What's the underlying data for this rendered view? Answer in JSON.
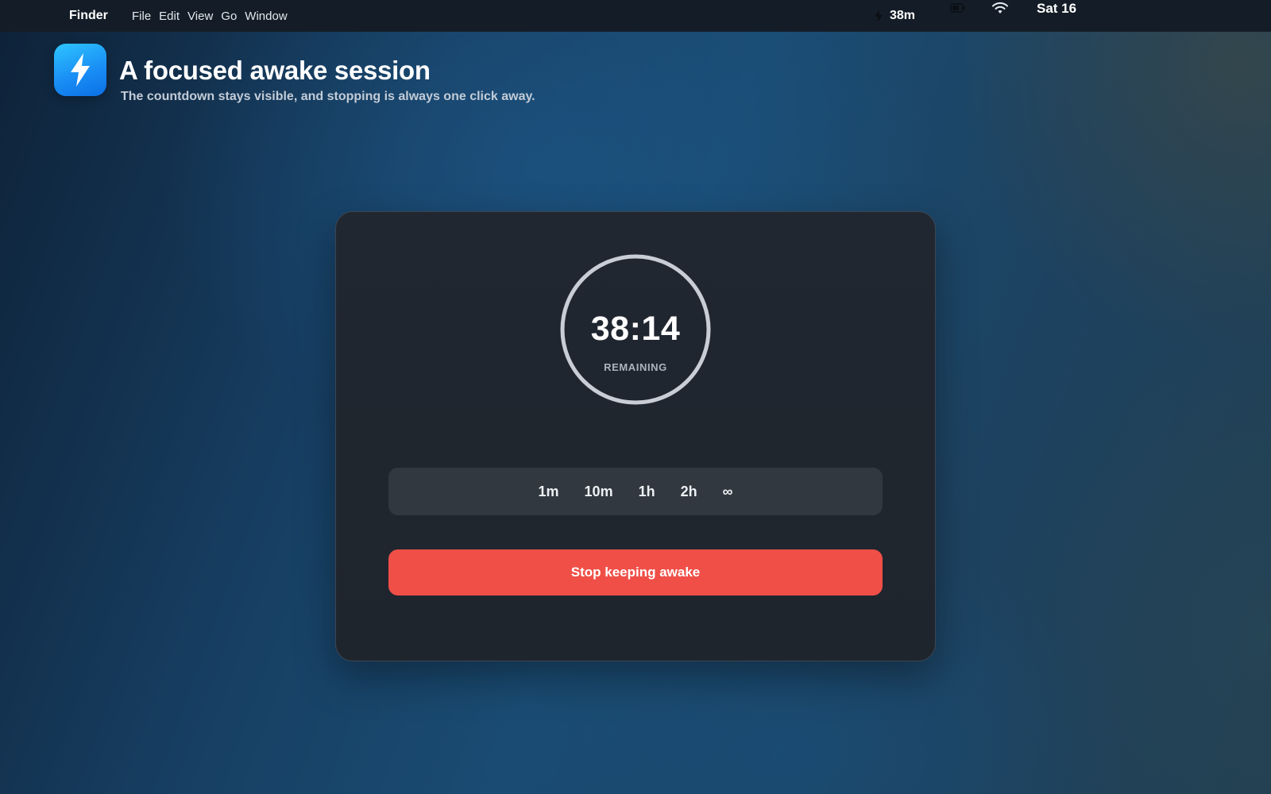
{
  "menubar": {
    "app_name": "Finder",
    "menus": [
      "File",
      "Edit",
      "View",
      "Go",
      "Window"
    ],
    "status_timer": "38m",
    "status_timer_icon": "bolt-icon",
    "battery_icon": "battery-icon",
    "wifi_icon": "wifi-icon",
    "clock": "Sat 16"
  },
  "header": {
    "app_icon": "bolt-icon",
    "title": "A focused awake session",
    "subtitle": "The countdown stays visible, and stopping is always one click away."
  },
  "timer": {
    "time": "38:14",
    "label": "REMAINING"
  },
  "durations": [
    "1m",
    "10m",
    "1h",
    "2h",
    "∞"
  ],
  "stop_button": "Stop keeping awake",
  "colors": {
    "accent_blue": "#1a8ff5",
    "stop_red": "#f04f48",
    "card_bg": "#212730",
    "ring": "#c9ced6"
  }
}
